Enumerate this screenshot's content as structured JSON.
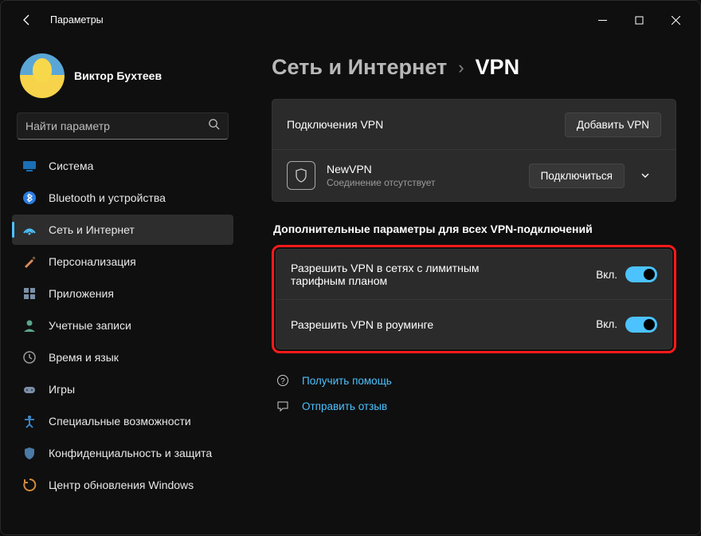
{
  "titlebar": {
    "title": "Параметры"
  },
  "profile": {
    "name": "Виктор Бухтеев",
    "email": ""
  },
  "search": {
    "placeholder": "Найти параметр"
  },
  "nav": [
    {
      "key": "system",
      "label": "Система",
      "icon_fg": "#1a6fb5",
      "icon_bg": "#0d3a5f"
    },
    {
      "key": "bluetooth",
      "label": "Bluetooth и устройства",
      "icon_fg": "#fff",
      "icon_bg": "#2a7de1"
    },
    {
      "key": "network",
      "label": "Сеть и Интернет",
      "icon_fg": "#4cc2ff",
      "icon_bg": "transparent",
      "selected": true
    },
    {
      "key": "personalization",
      "label": "Персонализация",
      "icon_fg": "#d98a5a",
      "icon_bg": "transparent"
    },
    {
      "key": "apps",
      "label": "Приложения",
      "icon_fg": "#7a8fa6",
      "icon_bg": "transparent"
    },
    {
      "key": "accounts",
      "label": "Учетные записи",
      "icon_fg": "#5aa68a",
      "icon_bg": "transparent"
    },
    {
      "key": "time",
      "label": "Время и язык",
      "icon_fg": "#9a9a9a",
      "icon_bg": "transparent"
    },
    {
      "key": "gaming",
      "label": "Игры",
      "icon_fg": "#7a8fa6",
      "icon_bg": "transparent"
    },
    {
      "key": "accessibility",
      "label": "Специальные возможности",
      "icon_fg": "#3a8fd6",
      "icon_bg": "transparent"
    },
    {
      "key": "privacy",
      "label": "Конфиденциальность и защита",
      "icon_fg": "#4a7aa6",
      "icon_bg": "transparent"
    },
    {
      "key": "update",
      "label": "Центр обновления Windows",
      "icon_fg": "#d68a3a",
      "icon_bg": "transparent"
    }
  ],
  "breadcrumb": {
    "parent": "Сеть и Интернет",
    "sep": "›",
    "current": "VPN"
  },
  "vpn_section": {
    "header": "Подключения VPN",
    "add_btn": "Добавить VPN",
    "connections": [
      {
        "name": "NewVPN",
        "status": "Соединение отсутствует",
        "connect_btn": "Подключиться"
      }
    ]
  },
  "additional": {
    "title": "Дополнительные параметры для всех VPN-подключений",
    "rows": [
      {
        "label": "Разрешить VPN в сетях с лимитным тарифным планом",
        "state_text": "Вкл.",
        "on": true
      },
      {
        "label": "Разрешить VPN в роуминге",
        "state_text": "Вкл.",
        "on": true
      }
    ]
  },
  "links": {
    "help": "Получить помощь",
    "feedback": "Отправить отзыв"
  }
}
